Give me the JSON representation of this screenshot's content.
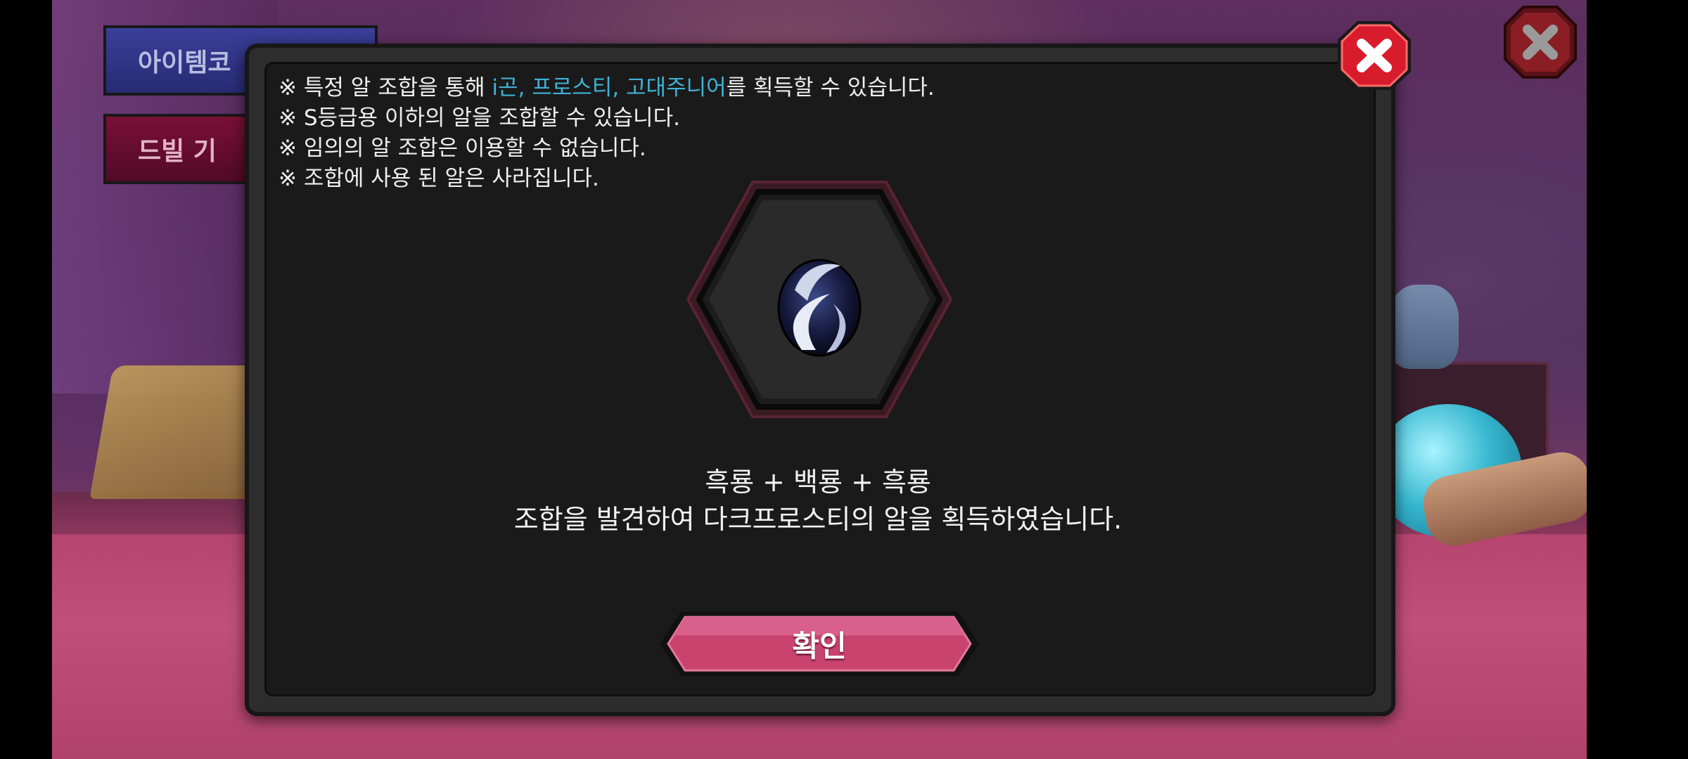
{
  "background": {
    "side_buttons": [
      {
        "label": "아이템코"
      },
      {
        "label": "드빌 기"
      }
    ]
  },
  "dialog": {
    "notes": [
      {
        "prefix": "※ 특정 알 조합을 통해 ",
        "highlight": "i곤, 프로스티, 고대주니어",
        "suffix": "를 획득할 수 있습니다."
      },
      {
        "prefix": "※ S등급용 이하의 알을 조합할 수 있습니다.",
        "highlight": "",
        "suffix": ""
      },
      {
        "prefix": "※ 임의의 알 조합은 이용할 수 없습니다.",
        "highlight": "",
        "suffix": ""
      },
      {
        "prefix": "※ 조합에 사용 된 알은 사라집니다.",
        "highlight": "",
        "suffix": ""
      }
    ],
    "result_combo": "흑룡 + 백룡 + 흑룡",
    "result_message": "조합을 발견하여 다크프로스티의 알을 획득하였습니다.",
    "confirm_label": "확인",
    "icons": {
      "close": "close-x-icon",
      "egg": "dark-frosty-egg-icon"
    },
    "colors": {
      "highlight": "#3fb2d6",
      "confirm_button": "#c8446e",
      "close_button": "#d81c2c"
    }
  }
}
